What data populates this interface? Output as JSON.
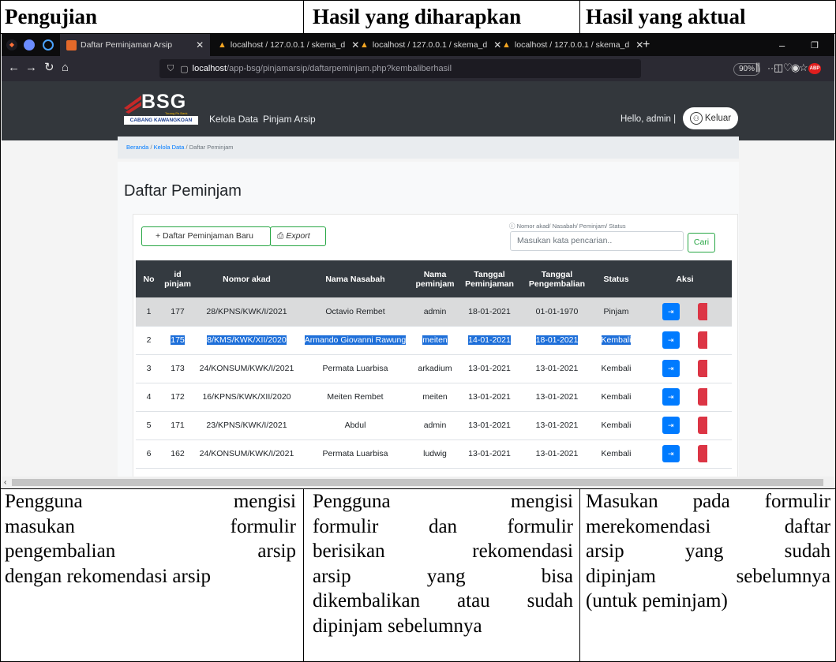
{
  "doc": {
    "headers": [
      "Pengujian",
      "Hasil yang diharapkan",
      "Hasil yang aktual"
    ],
    "col1_lines": [
      "Pengguna mengisi",
      "masukan formulir",
      "pengembalian arsip",
      "dengan rekomendasi arsip"
    ],
    "col2_lines": [
      "Pengguna mengisi",
      "formulir dan formulir",
      "berisikan rekomendasi",
      "arsip yang bisa",
      "dikembalikan atau sudah",
      "dipinjam sebelumnya"
    ],
    "col3_lines": [
      "Masukan pada formulir",
      "merekomendasi daftar",
      "arsip yang sudah",
      "dipinjam sebelumnya",
      "(untuk peminjam)"
    ]
  },
  "browser": {
    "tabs": [
      {
        "label": "Daftar Peminjaman Arsip",
        "close": "✕",
        "active": true
      },
      {
        "label": "localhost / 127.0.0.1 / skema_d",
        "close": "✕"
      },
      {
        "label": "localhost / 127.0.0.1 / skema_d",
        "close": "✕"
      },
      {
        "label": "localhost / 127.0.0.1 / skema_d",
        "close": "✕"
      }
    ],
    "new_tab": "+",
    "url_host": "localhost",
    "url_path": "/app-bsg/pinjamarsip/daftarpeminjam.php?kembaliberhasil",
    "zoom": "90%",
    "adblock_label": "ABP",
    "colors": {
      "tabbar": "#0c0c0d",
      "navbar": "#2b2a33"
    }
  },
  "site": {
    "logo_text": "BSG",
    "logo_tagline": "Torang Pe Bank",
    "logo_sub": "CABANG KAWANGKOAN",
    "nav": [
      "Kelola Data",
      "Pinjam Arsip"
    ],
    "hello": "Hello, admin |",
    "logout": "Keluar",
    "breadcrumb": {
      "home": "Beranda",
      "sep": "/",
      "mid": "Kelola Data",
      "current": "Daftar Peminjam"
    },
    "page_title": "Daftar Peminjam",
    "btn_new": "+ Daftar Peminjaman Baru",
    "btn_export": "Export",
    "search_hint": "ⓘ Nomor akad/ Nasabah/ Peminjam/ Status",
    "search_placeholder": "Masukan kata pencarian..",
    "btn_search": "Cari",
    "colors": {
      "header": "#33373c",
      "accent_green": "#28a745",
      "action_blue": "#007bff",
      "action_red": "#dc3545"
    }
  },
  "table": {
    "columns": [
      "No",
      "id pinjam",
      "Nomor akad",
      "Nama Nasabah",
      "Nama peminjam",
      "Tanggal Peminjaman",
      "Tanggal Pengembalian",
      "Status",
      "Aksi"
    ],
    "rows": [
      [
        "1",
        "177",
        "28/KPNS/KWK/I/2021",
        "Octavio Rembet",
        "admin",
        "18-01-2021",
        "01-01-1970",
        "Pinjam"
      ],
      [
        "2",
        "175",
        "8/KMS/KWK/XII/2020",
        "Armando Giovanni Rawung",
        "meiten",
        "14-01-2021",
        "18-01-2021",
        "Kembali"
      ],
      [
        "3",
        "173",
        "24/KONSUM/KWK/I/2021",
        "Permata Luarbisa",
        "arkadium",
        "13-01-2021",
        "13-01-2021",
        "Kembali"
      ],
      [
        "4",
        "172",
        "16/KPNS/KWK/XII/2020",
        "Meiten Rembet",
        "meiten",
        "13-01-2021",
        "13-01-2021",
        "Kembali"
      ],
      [
        "5",
        "171",
        "23/KPNS/KWK/I/2021",
        "Abdul",
        "admin",
        "13-01-2021",
        "13-01-2021",
        "Kembali"
      ],
      [
        "6",
        "162",
        "24/KONSUM/KWK/I/2021",
        "Permata Luarbisa",
        "ludwig",
        "13-01-2021",
        "13-01-2021",
        "Kembali"
      ]
    ]
  }
}
